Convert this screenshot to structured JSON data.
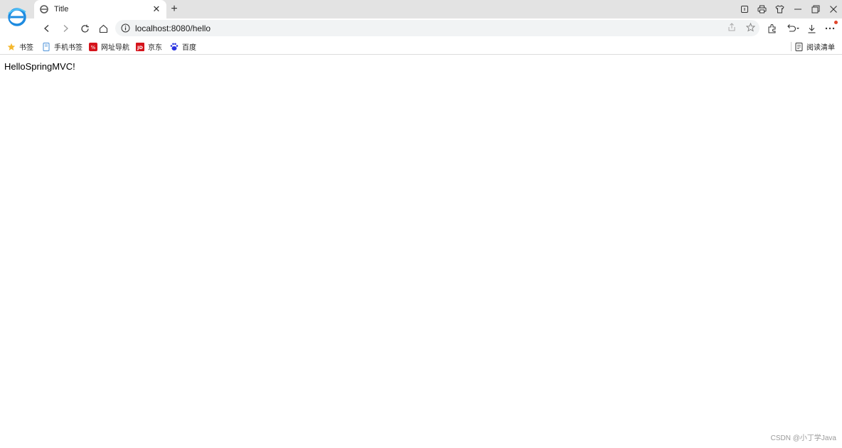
{
  "tab": {
    "title": "Title"
  },
  "address_bar": {
    "url": "localhost:8080/hello"
  },
  "bookmarks": [
    {
      "label": "书签",
      "icon": "star-icon"
    },
    {
      "label": "手机书签",
      "icon": "phone-bookmark-icon"
    },
    {
      "label": "网址导航",
      "icon": "nav-site-icon"
    },
    {
      "label": "京东",
      "icon": "jd-icon"
    },
    {
      "label": "百度",
      "icon": "baidu-icon"
    }
  ],
  "reading_list": {
    "label": "阅读清单"
  },
  "page": {
    "body_text": "HelloSpringMVC!"
  },
  "watermark": "CSDN @小丁学Java",
  "colors": {
    "accent_blue": "#1e8be0",
    "jd_red": "#d5141c",
    "baidu_blue": "#2932e1",
    "notify_dot": "#e0452b"
  }
}
